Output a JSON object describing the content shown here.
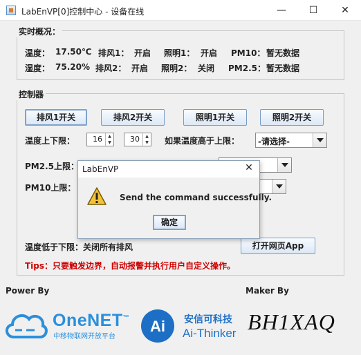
{
  "window": {
    "title": "LabEnVP[0]控制中心 - 设备在线",
    "min_glyph": "—",
    "max_glyph": "☐",
    "close_glyph": "✕"
  },
  "status_panel": {
    "title": "实时概况：",
    "temp_label": "温度：",
    "temp_value": "17.50℃",
    "humid_label": "湿度：",
    "humid_value": "75.20%",
    "fan1_label": "排风1：",
    "fan1_value": "开启",
    "fan2_label": "排风2：",
    "fan2_value": "开启",
    "light1_label": "照明1：",
    "light1_value": "开启",
    "light2_label": "照明2：",
    "light2_value": "关闭",
    "pm10_label": "PM10：",
    "pm10_value": "暂无数据",
    "pm25_label": "PM2.5：",
    "pm25_value": "暂无数据"
  },
  "control_panel": {
    "title": "控制器",
    "fan1_button": "排风1开关",
    "fan2_button": "排风2开关",
    "light1_button": "照明1开关",
    "light2_button": "照明2开关",
    "temp_limit_label": "温度上下限：",
    "temp_low_value": "16",
    "temp_high_value": "30",
    "above_label": "如果温度高于上限：",
    "above_select": "-请选择-",
    "pm25_label": "PM2.5上限：",
    "pm10_label": "PM10上限：",
    "below_label": "温度低于下限：关闭所有排风",
    "open_web_button": "打开网页App",
    "tips": "Tips：只要触发边界，自动报警并执行用户自定义操作。"
  },
  "footer": {
    "power_by": "Power By",
    "maker_by": "Maker By",
    "onenet_name": "OneNET",
    "onenet_tm": "™",
    "onenet_sub": "中移物联网开放平台",
    "ai_name": "安信可科技",
    "ai_sub": "Ai-Thinker",
    "maker_name": "BH1XAQ"
  },
  "dialog": {
    "title": "LabEnVP",
    "close_glyph": "✕",
    "message": "Send the command successfully.",
    "ok_label": "确定"
  }
}
